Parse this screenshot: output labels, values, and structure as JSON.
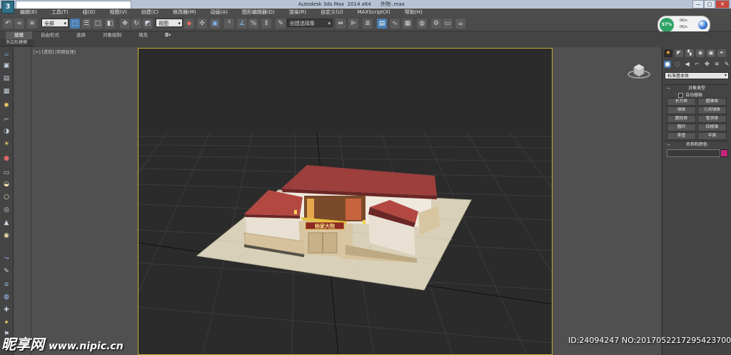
{
  "window": {
    "title": "Autodesk 3ds Max  2014 x64      外院-.max",
    "controls": [
      "—",
      "□",
      "✕"
    ]
  },
  "menu": [
    "编辑(E)",
    "工具(T)",
    "组(G)",
    "视图(V)",
    "创建(C)",
    "修改器(M)",
    "动画(A)",
    "图形编辑器(D)",
    "渲染(R)",
    "自定义(U)",
    "MAXScript(X)",
    "帮助(H)"
  ],
  "toolbar": {
    "selection_filter": "全部",
    "ref_coord": "视图",
    "named_selection": "创建选择集"
  },
  "net_widget": {
    "percent": "57%",
    "up": "0K/s",
    "down": "0K/s"
  },
  "ribbon": {
    "tabs": [
      "建模",
      "自由形式",
      "选择",
      "对象绘制",
      "填充"
    ],
    "extra": "◘▾",
    "subtitle": "多边形建模"
  },
  "viewport": {
    "label": "[+] [透视] [明暗处理]",
    "sign_text": "杨家大院"
  },
  "command_panel": {
    "dropdown": "标准基本体",
    "object_type_title": "对象类型",
    "autogrid_label": "自动栅格",
    "buttons": [
      "长方体",
      "圆锥体",
      "球体",
      "几何球体",
      "圆柱体",
      "管状体",
      "圆环",
      "四棱锥",
      "茶壶",
      "平面"
    ],
    "name_color_title": "名称和颜色",
    "swatch_color": "#c0277a"
  },
  "watermark": {
    "logo": "昵享网",
    "url": "www.nipic.cn",
    "id_text": "ID:24094247 NO:20170522172954237000"
  }
}
